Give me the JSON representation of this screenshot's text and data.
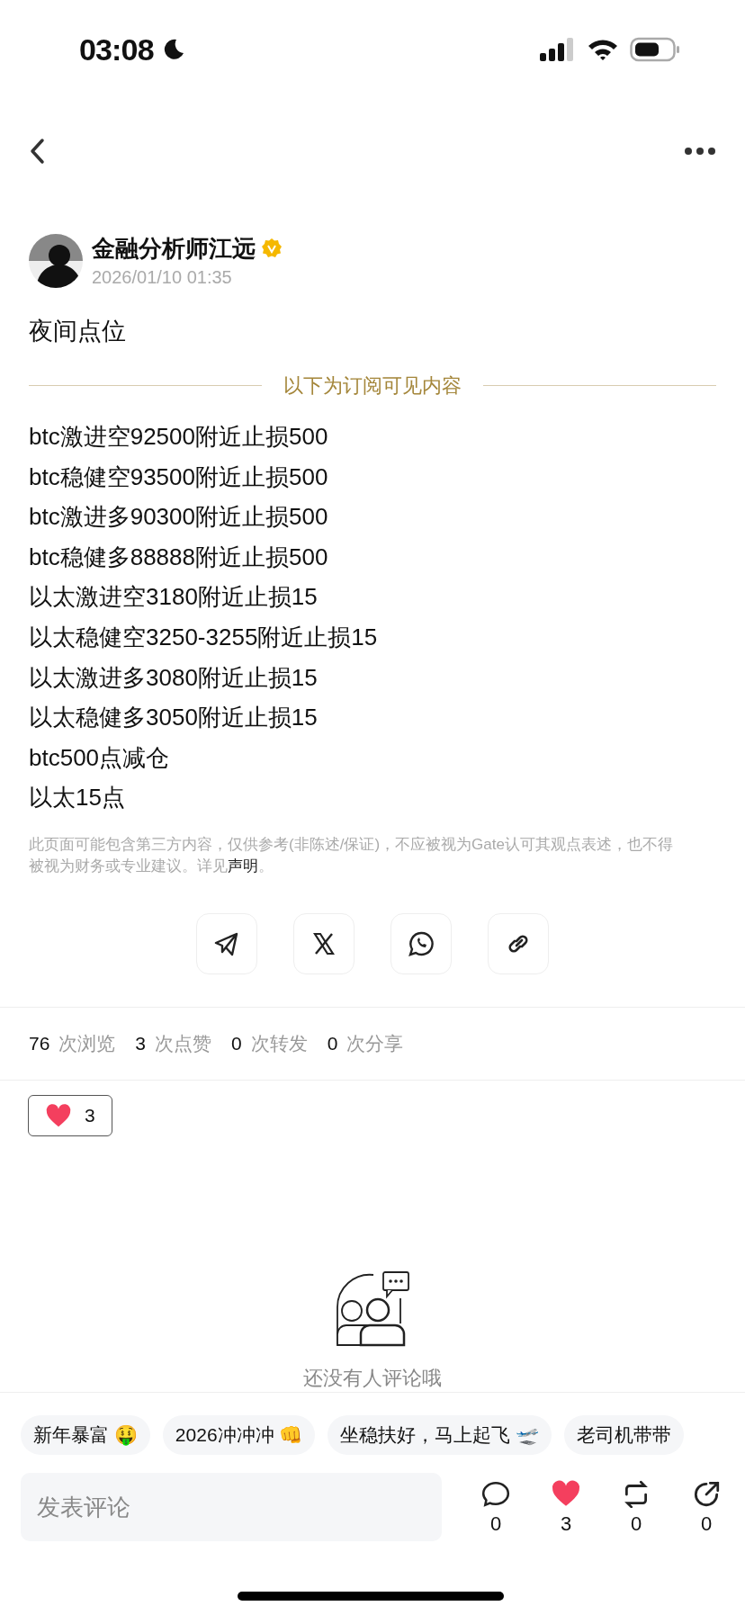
{
  "status_bar": {
    "time": "03:08"
  },
  "author": {
    "name": "金融分析师江远",
    "verified": true,
    "date": "2026/01/10 01:35"
  },
  "post": {
    "title": "夜间点位",
    "divider_label": "以下为订阅可见内容",
    "lines": [
      "btc激进空92500附近止损500",
      "btc稳健空93500附近止损500",
      "btc激进多90300附近止损500",
      "btc稳健多88888附近止损500",
      "以太激进空3180附近止损15",
      "以太稳健空3250-3255附近止损15",
      "以太激进多3080附近止损15",
      "以太稳健多3050附近止损15",
      "btc500点减仓",
      "以太15点"
    ],
    "disclaimer": "此页面可能包含第三方内容，仅供参考(非陈述/保证)，不应被视为Gate认可其观点表述，也不得被视为财务或专业建议。详见",
    "disclaimer_link": "声明",
    "disclaimer_end": "。"
  },
  "share_buttons": [
    {
      "kind": "telegram"
    },
    {
      "kind": "x"
    },
    {
      "kind": "whatsapp"
    },
    {
      "kind": "link"
    }
  ],
  "stats": [
    {
      "count": "76",
      "label": "次浏览"
    },
    {
      "count": "3",
      "label": "次点赞"
    },
    {
      "count": "0",
      "label": "次转发"
    },
    {
      "count": "0",
      "label": "次分享"
    }
  ],
  "reaction": {
    "count": "3"
  },
  "empty_comments": {
    "text": "还没有人评论哦"
  },
  "quick_replies": [
    "新年暴富 🤑",
    "2026冲冲冲 👊",
    "坐稳扶好，马上起飞 🛫",
    "老司机带带"
  ],
  "comment_field": {
    "placeholder": "发表评论"
  },
  "actions": [
    {
      "kind": "comment",
      "count": "0",
      "active": false
    },
    {
      "kind": "like",
      "count": "3",
      "active": true
    },
    {
      "kind": "repost",
      "count": "0",
      "active": false
    },
    {
      "kind": "share",
      "count": "0",
      "active": false
    }
  ]
}
